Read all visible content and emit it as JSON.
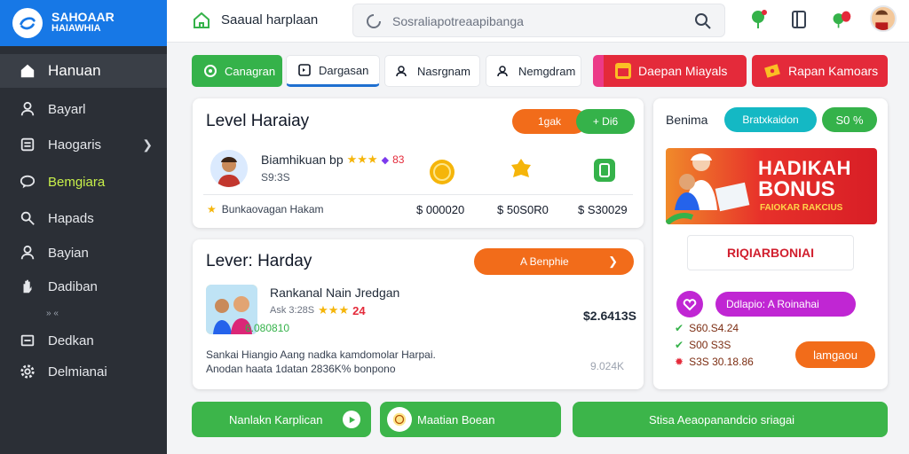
{
  "brand": {
    "line1": "SAHOAAR",
    "line2": "HAIAWHIA"
  },
  "sidebar": {
    "items": [
      {
        "label": "Hanuan",
        "icon": "home-icon"
      },
      {
        "label": "Bayarl",
        "icon": "user-icon"
      },
      {
        "label": "Haogaris",
        "icon": "list-icon"
      },
      {
        "label": "Bemgiara",
        "icon": "chat-icon"
      },
      {
        "label": "Hapads",
        "icon": "search-icon"
      },
      {
        "label": "Bayian",
        "icon": "user-icon"
      },
      {
        "label": "Dadiban",
        "icon": "hand-icon"
      },
      {
        "label": "Dedkan",
        "icon": "inbox-icon"
      },
      {
        "label": "Delmianai",
        "icon": "gear-icon"
      }
    ],
    "separator": "» «"
  },
  "topbar": {
    "title": "Saaual harplaan",
    "search_placeholder": "Sosraliapotreaapibanga"
  },
  "tabs": [
    {
      "label": "Canagran",
      "icon": "chat-icon"
    },
    {
      "label": "Dargasan",
      "icon": "box-icon"
    },
    {
      "label": "Nasrgnam",
      "icon": "people-icon"
    },
    {
      "label": "Nemgdram",
      "icon": "people-icon"
    },
    {
      "label": "Daepan Miayals",
      "icon": "gift-icon"
    },
    {
      "label": "Rapan Kamoars",
      "icon": "ticket-icon"
    }
  ],
  "card1": {
    "title": "Level Haraiay",
    "pill_left": "1gak",
    "pill_right": "+ Di6",
    "user_name": "Biamhikuan bp",
    "user_sub": "S9:3S",
    "rating_badge": "83",
    "footer_label": "Bunkaovagan Hakam",
    "prices": [
      "$ 000020",
      "$ 50S0R0",
      "$ S30029"
    ]
  },
  "card2": {
    "title": "Lever: Harday",
    "cta": "A Benphie",
    "product_title": "Rankanal Nain Jredgan",
    "product_meta": "Ask 3:28S",
    "rating": "24",
    "product_code": "6.080810",
    "price": "$2.6413S",
    "desc_line1": "Sankai Hiangio Aang nadka kamdomolar Harpai.",
    "desc_line2": "Anodan haata 1datan 2836K% bonpono",
    "desc_value": "9.024K"
  },
  "right": {
    "label": "Benima",
    "pill_teal": "Bratxkaidon",
    "pill_green": "S0 %",
    "banner_line1": "HADIKAH",
    "banner_line2": "BONUS",
    "banner_line3": "FAIOKAR RAKCIUS",
    "outline_text": "RIQIARBONIAI",
    "promo": "Ddlapio: A Roinahai",
    "list": [
      "S60.S4.24",
      "S00 S3S",
      "S3S 30.18.86"
    ],
    "button": "lamgaou"
  },
  "bottom": {
    "btn1": "Nanlakn Karplican",
    "btn2": "Maatian Boean",
    "btn3": "Stisa Aeaopanandcio sriagai"
  }
}
